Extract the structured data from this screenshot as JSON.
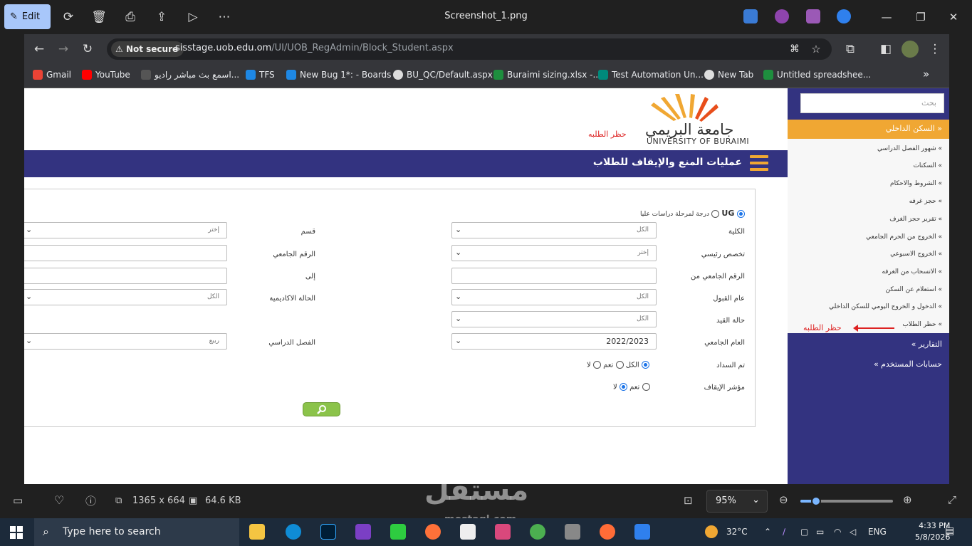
{
  "viewer": {
    "edit_label": "Edit",
    "file_title": "Screenshot_1.png",
    "image_dims": "1365 x 664",
    "file_size": "64.6 KB",
    "zoom_level": "95%",
    "zoom_fraction": 0.17
  },
  "browser": {
    "not_secure_label": "Not secure",
    "url_host": "sisstage.uob.edu.om",
    "url_path": "/UI/UOB_RegAdmin/Block_Student.aspx",
    "bookmarks": [
      {
        "label": "Gmail",
        "color": "#ea4335"
      },
      {
        "label": "YouTube",
        "color": "#ff0000"
      },
      {
        "label": "اسمع بث مباشر راديو...",
        "color": "#555555"
      },
      {
        "label": "TFS",
        "color": "#1e88e5"
      },
      {
        "label": "New Bug 1*: - Boards",
        "color": "#1e88e5"
      },
      {
        "label": "BU_QC/Default.aspx",
        "color": "#dddddd"
      },
      {
        "label": "Buraimi sizing.xlsx -...",
        "color": "#1e8e3e"
      },
      {
        "label": "Test Automation Un...",
        "color": "#00897b"
      },
      {
        "label": "New Tab",
        "color": "#dddddd"
      },
      {
        "label": "Untitled spreadshee...",
        "color": "#1e8e3e"
      }
    ]
  },
  "header": {
    "logo_ar": "جامعة البريمي",
    "logo_en": "UNIVERSITY OF BURAIMI",
    "page_link": "حظر الطلبه",
    "page_title": "عمليات المنع والإيقاف للطلاب"
  },
  "form": {
    "level_ug": "UG",
    "level_pg": "درجة لمرحلة دراسات عليا",
    "college_label": "الكلية",
    "college_value": "الكل",
    "dept_label": "قسم",
    "dept_value": "إختر",
    "major_label": "تخصص رئيسي",
    "major_value": "إختر",
    "uni_id_label": "الرقم الجامعي",
    "uni_id_from_label": "الرقم الجامعي من",
    "to_label": "إلى",
    "admit_year_label": "عام القبول",
    "admit_year_value": "الكل",
    "academic_status_label": "الحالة الاكاديمية",
    "academic_status_value": "الكل",
    "enroll_status_label": "حالة القيد",
    "enroll_status_value": "الكل",
    "academic_year_label": "العام الجامعي",
    "academic_year_value": "2022/2023",
    "semester_label": "الفصل الدراسي",
    "semester_value": "ربيع",
    "paid_label": "تم السداد",
    "paid_opt_all": "الكل",
    "paid_opt_yes": "نعم",
    "paid_opt_no": "لا",
    "stop_label": "مؤشر الإيقاف",
    "stop_opt_yes": "نعم",
    "stop_opt_no": "لا",
    "search_icon": "magnifier-icon"
  },
  "sidebar": {
    "search_placeholder": "بحث",
    "housing_label": "السكن الداخلي",
    "sub_items": [
      "شهور الفصل الدراسي",
      "السكنات",
      "الشروط والاحكام",
      "حجز غرفه",
      "تقرير حجز الغرف",
      "الخروج من الحرم الجامعي",
      "الخروج الاسبوعي",
      "الانسحاب من الغرفه",
      "استعلام عن السكن",
      "الدخول و الخروج اليومي للسكن الداخلي",
      "حظر الطلاب"
    ],
    "annotation": "حظر الطلبه",
    "reports_label": "التقارير",
    "accounts_label": "حسابات المستخدم"
  },
  "taskbar": {
    "search_placeholder": "Type here to search",
    "weather": "32°C",
    "language": "ENG",
    "time": "4:33 PM",
    "date": "5/8/2026"
  },
  "watermark": {
    "ar": "مستقل",
    "en": "mostaql.com"
  }
}
